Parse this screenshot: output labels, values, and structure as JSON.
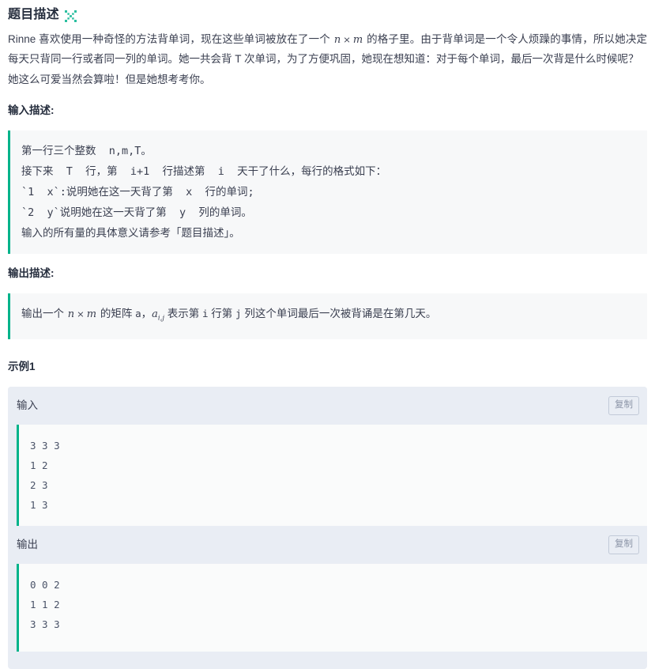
{
  "header": {
    "title": "题目描述",
    "expand_icon": "expand-arrows-icon",
    "icon_color": "#2bbfa0"
  },
  "description": {
    "paragraph1_part1": "Rinne 喜欢使用一种奇怪的方法背单词，现在这些单词被放在了一个 ",
    "paragraph1_n": "n",
    "paragraph1_times": "×",
    "paragraph1_m": "m",
    "paragraph1_part2": " 的格子里。由于背单词是一个令人烦躁的事情，所以她决定每天只背同一行或者同一列的单词。她一共会背 T 次单词，为了方便巩固，她现在想知道：对于每个单词，最后一次背是什么时候呢？",
    "paragraph2": "她这么可爱当然会算啦！但是她想考考你。"
  },
  "input_section": {
    "heading": "输入描述:",
    "lines": [
      "第一行三个整数  n,m,T。",
      "接下来  T  行，第  i+1  行描述第  i  天干了什么，每行的格式如下：",
      "`1  x`:说明她在这一天背了第  x  行的单词;",
      "`2  y`说明她在这一天背了第  y  列的单词。",
      "输入的所有量的具体意义请参考「题目描述」。"
    ]
  },
  "output_section": {
    "heading": "输出描述:",
    "line_part1": "输出一个 ",
    "line_n": "n",
    "line_times": "×",
    "line_m": "m",
    "line_part2": " 的矩阵 ",
    "line_a": "a",
    "line_part3": "，",
    "line_aij": "a",
    "line_aij_sub": "i,j",
    "line_part4": " 表示第 ",
    "line_i": "i",
    "line_part5": " 行第 ",
    "line_j": "j",
    "line_part6": " 列这个单词最后一次被背诵是在第几天。"
  },
  "example": {
    "title": "示例1",
    "input": {
      "label": "输入",
      "copy_label": "复制",
      "lines": [
        "3 3 3",
        "1 2",
        "2 3",
        "1 3"
      ]
    },
    "output": {
      "label": "输出",
      "copy_label": "复制",
      "lines": [
        "0 0 2",
        "1 1 2",
        "3 3 3"
      ]
    }
  },
  "colors": {
    "accent_green": "#00b38a",
    "panel_bg": "#e9edf4",
    "quote_bg": "#f7f8f9",
    "text": "#3a3f50"
  }
}
